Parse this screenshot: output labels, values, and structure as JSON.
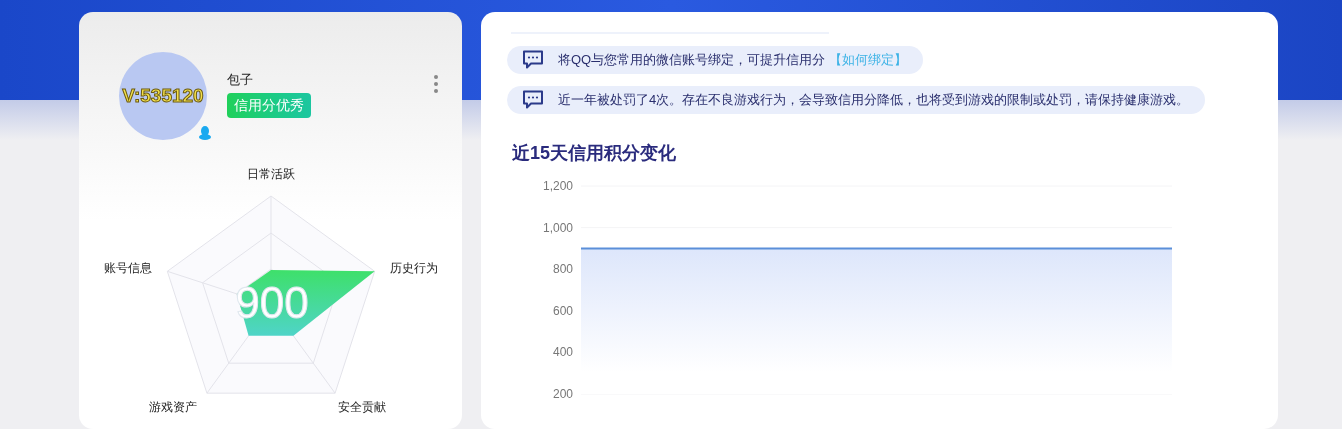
{
  "profile": {
    "name": "包子",
    "badge": "信用分优秀",
    "avatar_overlay": "V:535120"
  },
  "radar": {
    "score": "900",
    "axes": [
      "日常活跃",
      "历史行为",
      "安全贡献",
      "游戏资产",
      "账号信息"
    ]
  },
  "notices": [
    {
      "text": "将QQ与您常用的微信账号绑定，可提升信用分",
      "link": "【如何绑定】"
    },
    {
      "text": "近一年被处罚了4次。存在不良游戏行为，会导致信用分降低，也将受到游戏的限制或处罚，请保持健康游戏。"
    }
  ],
  "chart": {
    "title": "近15天信用积分变化",
    "chart_data": {
      "type": "area",
      "ylim": [
        200,
        1200
      ],
      "yticks": [
        {
          "value": 1200,
          "label": "1,200"
        },
        {
          "value": 1000,
          "label": "1,000"
        },
        {
          "value": 800,
          "label": "800"
        },
        {
          "value": 600,
          "label": "600"
        },
        {
          "value": 400,
          "label": "400"
        },
        {
          "value": 200,
          "label": "200"
        }
      ],
      "series": [
        {
          "color": "#5b8fd9",
          "values": [
            900,
            900,
            900,
            900,
            900,
            900,
            900,
            900,
            900,
            900,
            900,
            900,
            900,
            900,
            900
          ]
        }
      ]
    }
  }
}
